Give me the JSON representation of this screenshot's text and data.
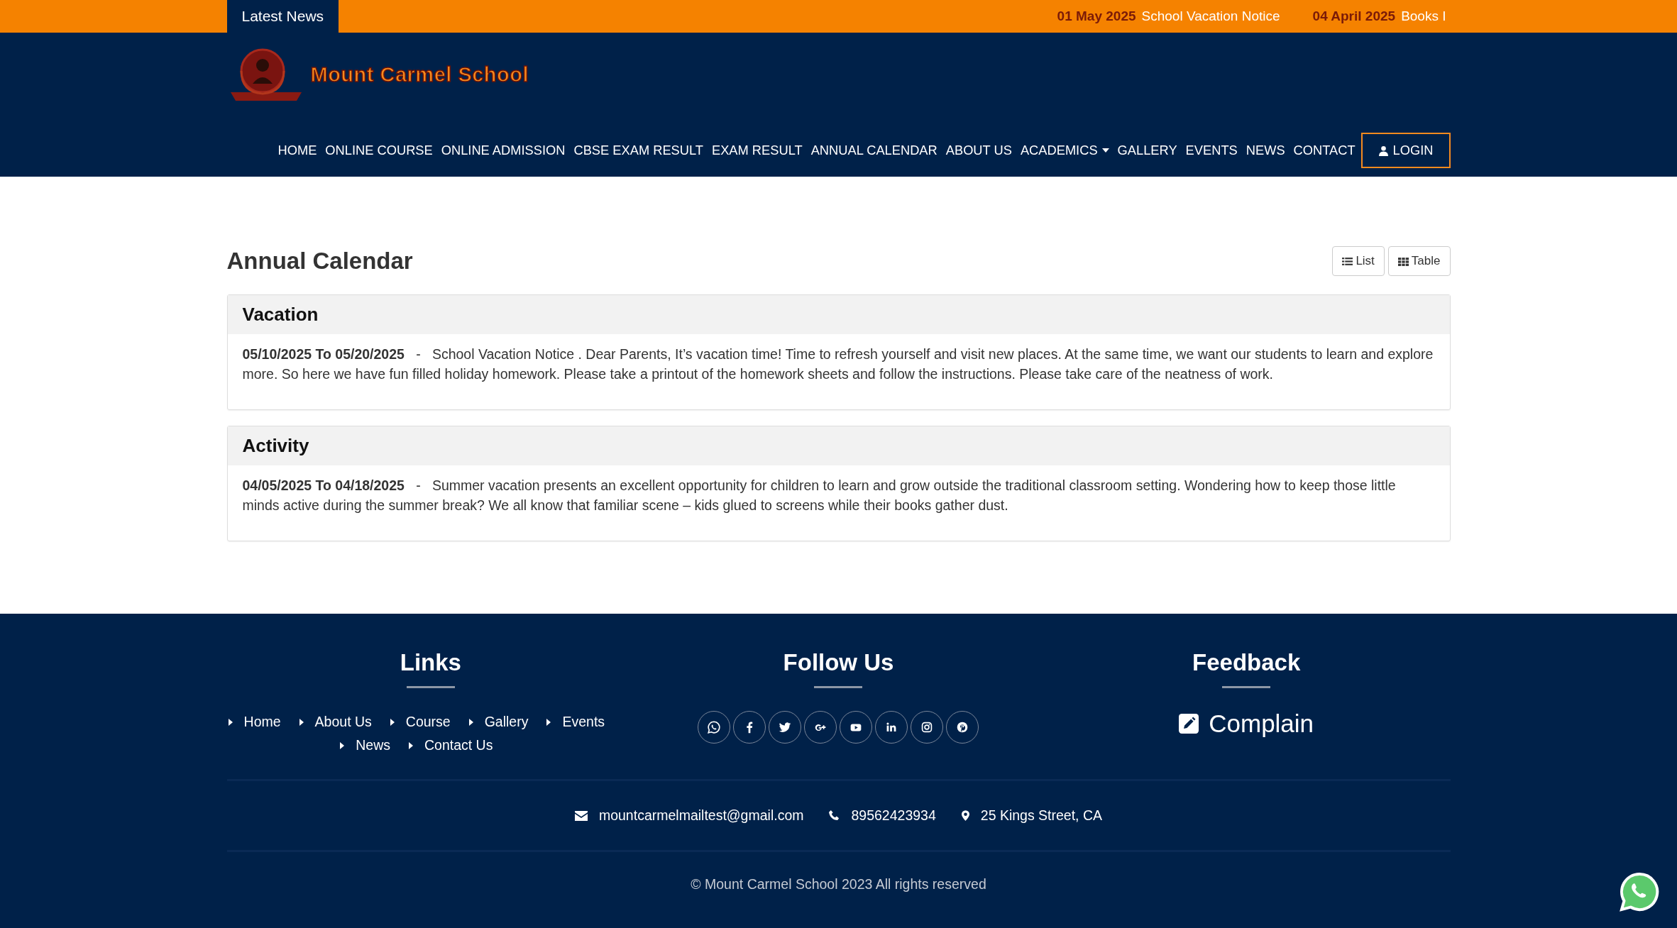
{
  "news_bar": {
    "label": "Latest News",
    "items": [
      {
        "date": "01 May 2025",
        "title": "School Vacation Notice"
      },
      {
        "date": "04 April 2025",
        "title": "Books I"
      }
    ]
  },
  "header": {
    "school_name": "Mount Carmel School",
    "nav": [
      {
        "label": "HOME",
        "kind": "link"
      },
      {
        "label": "ONLINE COURSE",
        "kind": "link"
      },
      {
        "label": "ONLINE ADMISSION",
        "kind": "link"
      },
      {
        "label": "CBSE EXAM RESULT",
        "kind": "link"
      },
      {
        "label": "EXAM RESULT",
        "kind": "link"
      },
      {
        "label": "ANNUAL CALENDAR",
        "kind": "link"
      },
      {
        "label": "ABOUT US",
        "kind": "link"
      },
      {
        "label": "ACADEMICS",
        "kind": "dropdown"
      },
      {
        "label": "GALLERY",
        "kind": "link"
      },
      {
        "label": "EVENTS",
        "kind": "link"
      },
      {
        "label": "NEWS",
        "kind": "link"
      },
      {
        "label": "CONTACT",
        "kind": "link"
      },
      {
        "label": "LOGIN",
        "kind": "login"
      }
    ]
  },
  "page": {
    "title": "Annual Calendar",
    "views": [
      {
        "label": "List",
        "kind": "list"
      },
      {
        "label": "Table",
        "kind": "table"
      }
    ]
  },
  "events": [
    {
      "category": "Vacation",
      "dates": "05/10/2025 To 05/20/2025",
      "separator": "-",
      "description": "School Vacation Notice . Dear Parents, It’s vacation time! Time to refresh yourself and visit new places. At the same time, we want our students to learn and explore more. So here we have fun filled holiday homework. Please take a printout of the homework sheets and follow the instructions. Please take care of the neatness of work."
    },
    {
      "category": "Activity",
      "dates": "04/05/2025 To 04/18/2025",
      "separator": "-",
      "description": "Summer vacation presents an excellent opportunity for children to learn and grow outside the traditional classroom setting. Wondering how to keep those little minds active during the summer break? We all know that familiar scene – kids glued to screens while their books gather dust."
    }
  ],
  "footer": {
    "links": {
      "title": "Links",
      "items": [
        "Home",
        "About Us",
        "Course",
        "Gallery",
        "Events",
        "News",
        "Contact Us"
      ]
    },
    "follow": {
      "title": "Follow Us",
      "socials": [
        {
          "kind": "whatsapp"
        },
        {
          "kind": "facebook"
        },
        {
          "kind": "twitter"
        },
        {
          "kind": "googleplus"
        },
        {
          "kind": "youtube"
        },
        {
          "kind": "linkedin"
        },
        {
          "kind": "instagram"
        },
        {
          "kind": "pinterest"
        }
      ]
    },
    "feedback": {
      "title": "Feedback",
      "action": "Complain"
    },
    "contacts": [
      {
        "kind": "email",
        "text": "mountcarmelmailtest@gmail.com"
      },
      {
        "kind": "phone",
        "text": "89562423934"
      },
      {
        "kind": "address",
        "text": "25 Kings Street, CA"
      }
    ],
    "copyright": "© Mount Carmel School 2023 All rights reserved"
  }
}
